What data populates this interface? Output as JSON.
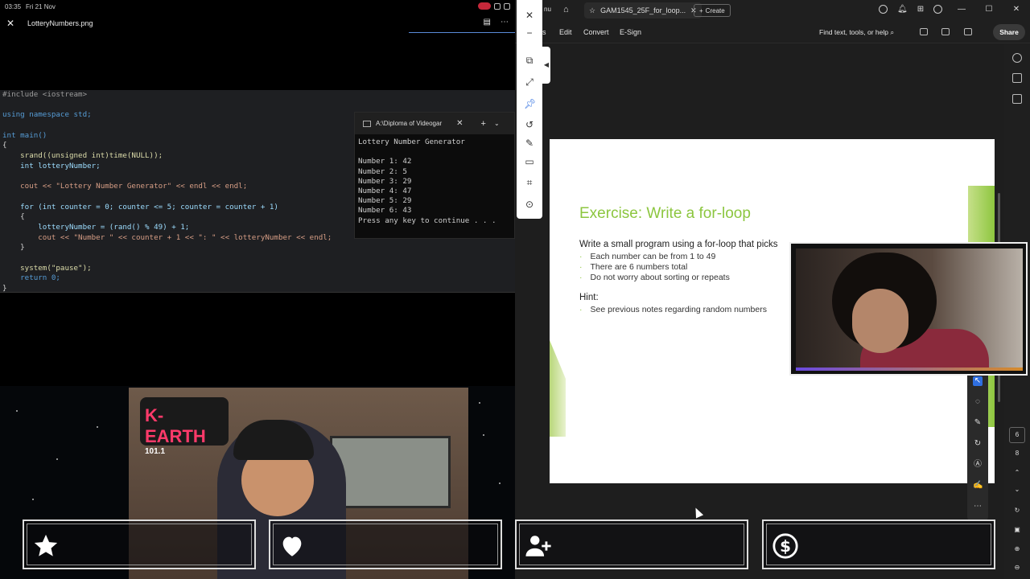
{
  "status_bar": {
    "time": "03:35",
    "date": "Fri 21 Nov"
  },
  "viewer": {
    "title": "LotteryNumbers.png",
    "close_icon": "close-icon",
    "actions": [
      "comment-icon",
      "more-icon"
    ]
  },
  "code": {
    "lines": [
      "#include <iostream>",
      "",
      "using namespace std;",
      "",
      "int main()",
      "{",
      "    srand((unsigned int)time(NULL));",
      "    int lotteryNumber;",
      "",
      "    cout << \"Lottery Number Generator\" << endl << endl;",
      "",
      "    for (int counter = 0; counter <= 5; counter = counter + 1)",
      "    {",
      "        lotteryNumber = (rand() % 49) + 1;",
      "        cout << \"Number \" << counter + 1 << \": \" << lotteryNumber << endl;",
      "    }",
      "",
      "    system(\"pause\");",
      "    return 0;",
      "}"
    ]
  },
  "terminal": {
    "tab_title": "A:\\Diploma of Videogar",
    "plus": "+",
    "output": [
      "Lottery Number Generator",
      "",
      "Number 1: 42",
      "Number 2: 5",
      "Number 3: 29",
      "Number 4: 47",
      "Number 5: 29",
      "Number 6: 43",
      "Press any key to continue . . ."
    ]
  },
  "pdf": {
    "menu_cut": "nu",
    "tab_title": "GAM1545_25F_for_loop...",
    "create": "Create",
    "menu": [
      "s",
      "Edit",
      "Convert",
      "E-Sign"
    ],
    "find": "Find text, tools, or help",
    "share": "Share",
    "page_numbers": [
      "6",
      "8"
    ]
  },
  "slide": {
    "title": "Exercise: Write a for-loop",
    "intro": "Write a small program using a for-loop that picks",
    "bullets": [
      "Each number can be from 1 to 49",
      "There are 6 numbers total",
      "Do not worry about sorting or repeats"
    ],
    "hint_label": "Hint:",
    "hint_bullets": [
      "See previous notes regarding random numbers"
    ]
  },
  "video": {
    "logo": "K-EARTH",
    "logo_sub": "101.1"
  },
  "alerts": [
    {
      "icon": "star-icon"
    },
    {
      "icon": "heart-icon"
    },
    {
      "icon": "add-user-icon"
    },
    {
      "icon": "dollar-icon"
    }
  ],
  "colors": {
    "slide_green": "#8cc63f",
    "accent_blue": "#2f6fe0",
    "rec_red": "#c6283a"
  }
}
